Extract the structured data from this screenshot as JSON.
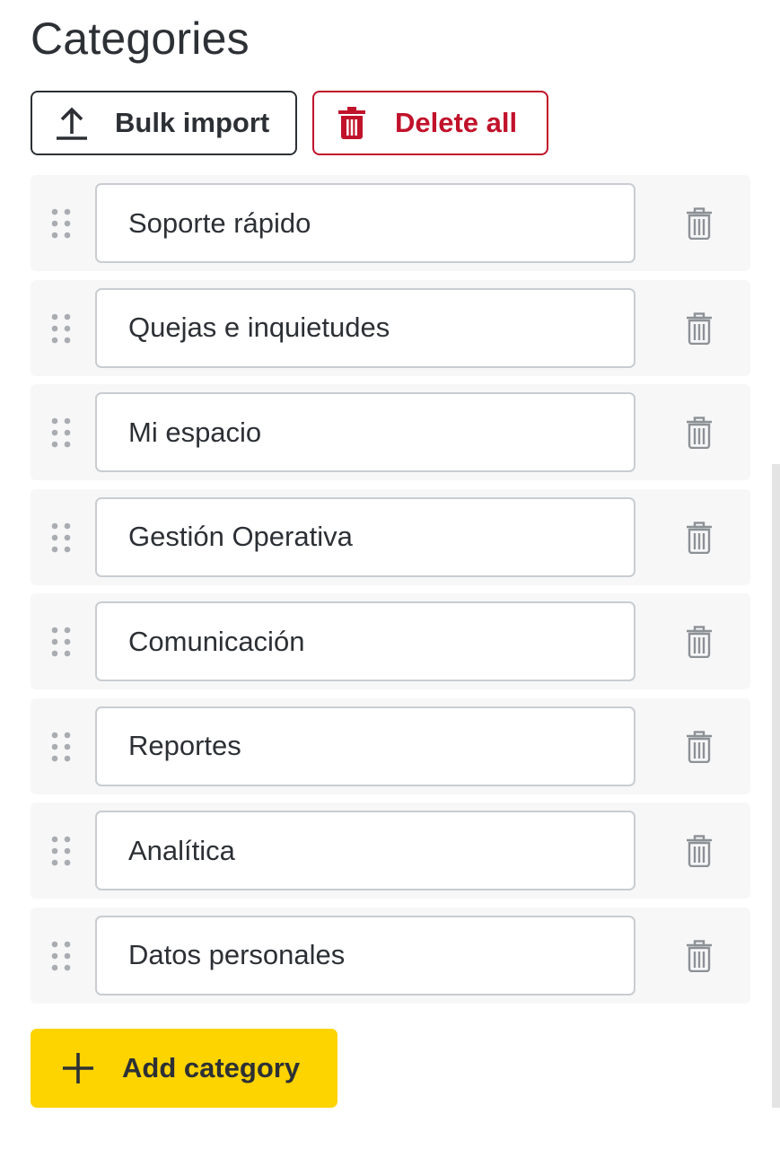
{
  "page": {
    "title": "Categories"
  },
  "toolbar": {
    "bulk_import_label": "Bulk import",
    "bulk_import_icon": "upload-icon",
    "delete_all_label": "Delete all",
    "delete_all_icon": "trash-icon"
  },
  "categories": [
    {
      "value": "Soporte rápido"
    },
    {
      "value": "Quejas e inquietudes"
    },
    {
      "value": "Mi espacio"
    },
    {
      "value": "Gestión Operativa"
    },
    {
      "value": "Comunicación"
    },
    {
      "value": "Reportes"
    },
    {
      "value": "Analítica"
    },
    {
      "value": "Datos personales"
    }
  ],
  "row_icons": {
    "handle": "drag-handle-icon",
    "delete": "trash-icon"
  },
  "add_button": {
    "label": "Add category",
    "icon": "plus-icon"
  },
  "colors": {
    "text": "#2c3035",
    "danger": "#c1122b",
    "accent": "#fdd300",
    "row_background": "#f7f7f8",
    "muted_icon": "#8c9196"
  }
}
